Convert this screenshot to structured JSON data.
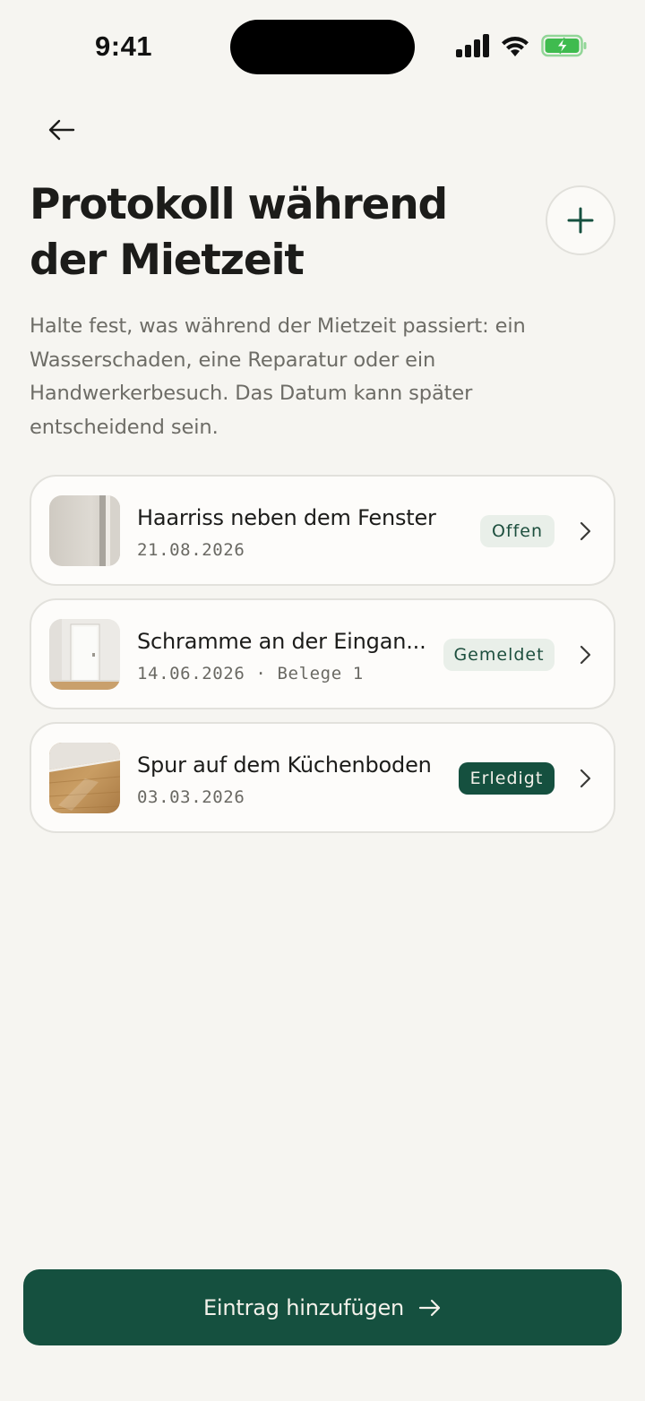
{
  "status_bar": {
    "time": "9:41",
    "icons": [
      "signal-icon",
      "wifi-icon",
      "battery-charging-icon"
    ],
    "battery_color": "#3fbb4f"
  },
  "header": {
    "back_icon": "arrow-left-icon",
    "title": "Protokoll während der Mietzeit",
    "add_icon": "plus-icon",
    "description": "Halte fest, was während der Mietzeit passiert: ein Wasserschaden, eine Reparatur oder ein Handwerkerbesuch. Das Datum kann später entscheidend sein."
  },
  "entries": [
    {
      "title": "Haarriss neben dem Fenster",
      "meta": "21.08.2026",
      "status": "Offen",
      "status_style": "soft",
      "thumbnail": "wall-crack-photo"
    },
    {
      "title": "Schramme an der Eingan...",
      "meta": "14.06.2026 · Belege 1",
      "status": "Gemeldet",
      "status_style": "soft",
      "thumbnail": "entrance-door-photo"
    },
    {
      "title": "Spur auf dem Küchenboden",
      "meta": "03.03.2026",
      "status": "Erledigt",
      "status_style": "solid",
      "thumbnail": "kitchen-floor-photo"
    }
  ],
  "cta": {
    "label": "Eintrag hinzufügen",
    "icon": "arrow-right-icon"
  },
  "colors": {
    "background": "#f6f5f1",
    "brand_green": "#15503f",
    "soft_badge": "#e9efe9"
  }
}
